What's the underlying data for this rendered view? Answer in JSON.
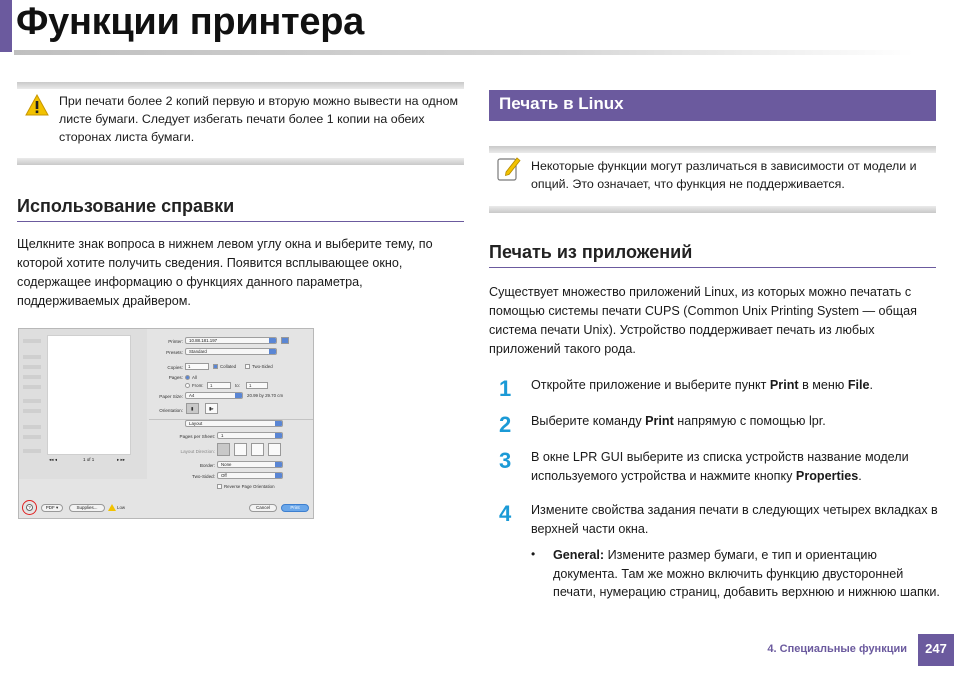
{
  "page": {
    "title": "Функции принтера",
    "footer_label": "4. Специальные функции",
    "page_number": "247"
  },
  "left": {
    "caution_text": "При печати более 2 копий первую и вторую можно вывести на одном листе бумаги. Следует избегать печати более 1 копии на обеих сторонах листа бумаги.",
    "help_heading": "Использование справки",
    "help_text": "Щелкните знак вопроса в нижнем левом углу окна и выберите тему, по которой хотите получить сведения. Появится всплывающее окно, содержащее информацию о функциях данного параметра, поддерживаемых драйвером."
  },
  "dialog": {
    "printer_label": "Printer:",
    "printer_value": "10.88.181.197",
    "presets_label": "Presets:",
    "presets_value": "Standard",
    "copies_label": "Copies:",
    "copies_value": "1",
    "collated_label": "Collated",
    "two_sided_label": "Two-Sided",
    "pages_label": "Pages:",
    "all_label": "All",
    "from_label": "From:",
    "from_value": "1",
    "to_label": "to:",
    "to_value": "1",
    "paper_size_label": "Paper Size:",
    "paper_size_value": "A4",
    "paper_dims": "20.99 by 29.70 cm",
    "orientation_label": "Orientation:",
    "panel_value": "Layout",
    "pages_per_sheet_label": "Pages per Sheet:",
    "pages_per_sheet_value": "1",
    "layout_direction_label": "Layout Direction:",
    "border_label": "Border:",
    "border_value": "None",
    "two_sided_select_label": "Two-Sided:",
    "two_sided_value": "Off",
    "reverse_label": "Reverse Page Orientation",
    "page_counter": "1 of 1",
    "help_symbol": "?",
    "pdf_button": "PDF ▾",
    "supplies_button": "Supplies...",
    "low_label": "Low",
    "cancel_button": "Cancel",
    "print_button": "Print"
  },
  "right": {
    "section_title": "Печать в Linux",
    "note_text": "Некоторые функции могут различаться в зависимости от модели и опций. Это означает, что функция не поддерживается.",
    "apps_heading": "Печать из приложений",
    "apps_text": "Существует множество приложений Linux, из которых можно печатать с помощью системы печати CUPS (Common Unix Printing System — общая система печати Unix). Устройство поддерживает печать из любых приложений такого рода.",
    "steps": [
      {
        "num": "1",
        "pre": "Откройте приложение и выберите пункт ",
        "b1": "Print",
        "mid": " в меню ",
        "b2": "File",
        "post": "."
      },
      {
        "num": "2",
        "pre": "Выберите команду ",
        "b1": "Print",
        "mid": " напрямую с помощью lpr.",
        "b2": "",
        "post": ""
      },
      {
        "num": "3",
        "pre": "В окне LPR GUI выберите из списка устройств название модели используемого устройства и нажмите кнопку ",
        "b1": "Properties",
        "mid": ".",
        "b2": "",
        "post": ""
      },
      {
        "num": "4",
        "pre": "Измените свойства задания печати в следующих четырех вкладках в верхней части окна.",
        "b1": "",
        "mid": "",
        "b2": "",
        "post": ""
      }
    ],
    "bullet_mark": "•",
    "bullet_bold": "General:",
    "bullet_text": " Измените размер бумаги, е тип и ориентацию документа. Там же можно включить функцию двусторонней печати, нумерацию страниц, добавить верхнюю и нижнюю шапки."
  }
}
